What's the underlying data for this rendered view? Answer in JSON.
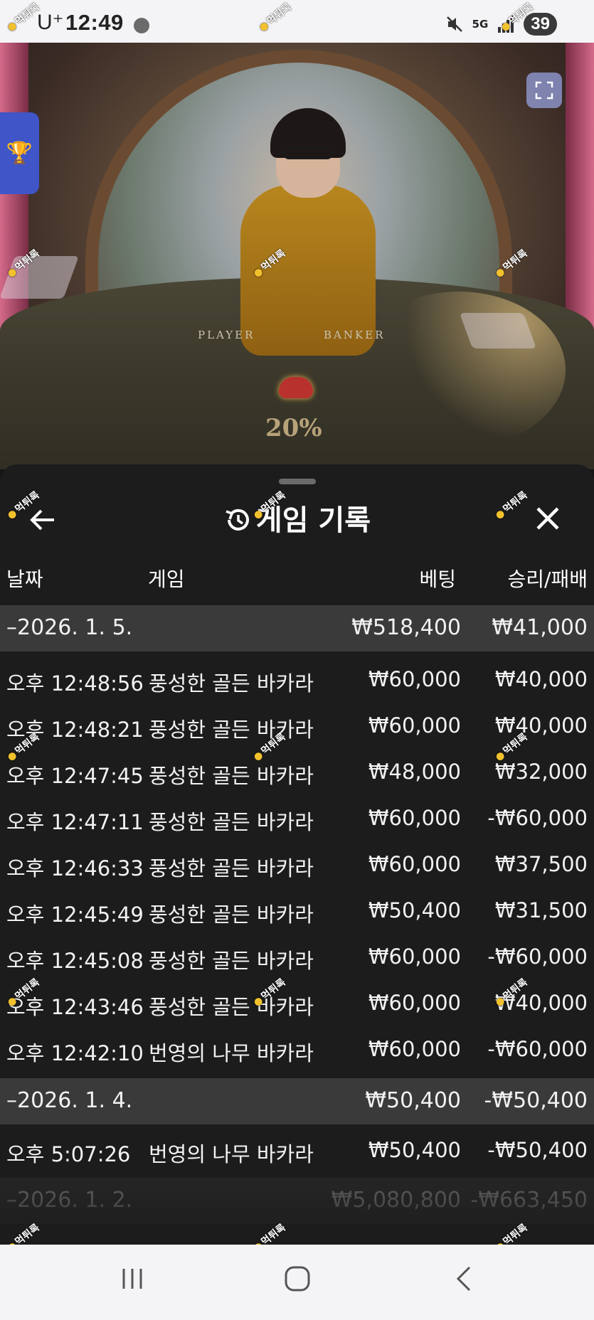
{
  "status_bar": {
    "carrier": "U⁺",
    "time": "12:49",
    "network": "5G",
    "battery": "39"
  },
  "video": {
    "table_left_label": "PLAYER",
    "table_right_label": "BANKER",
    "payout_percent": "20%"
  },
  "sheet": {
    "title": "게임 기록",
    "columns": {
      "date": "날짜",
      "game": "게임",
      "bet": "베팅",
      "result": "승리/패배"
    },
    "rows": [
      {
        "kind": "group",
        "date": "–2026. 1. 5.",
        "bet": "₩518,400",
        "result": "₩41,000"
      },
      {
        "kind": "item",
        "time": "오후 12:48:56",
        "game": "풍성한 골든 바카라",
        "bet": "₩60,000",
        "result": "₩40,000"
      },
      {
        "kind": "item",
        "time": "오후 12:48:21",
        "game": "풍성한 골든 바카라",
        "bet": "₩60,000",
        "result": "₩40,000"
      },
      {
        "kind": "item",
        "time": "오후 12:47:45",
        "game": "풍성한 골든 바카라",
        "bet": "₩48,000",
        "result": "₩32,000"
      },
      {
        "kind": "item",
        "time": "오후 12:47:11",
        "game": "풍성한 골든 바카라",
        "bet": "₩60,000",
        "result": "-₩60,000"
      },
      {
        "kind": "item",
        "time": "오후 12:46:33",
        "game": "풍성한 골든 바카라",
        "bet": "₩60,000",
        "result": "₩37,500"
      },
      {
        "kind": "item",
        "time": "오후 12:45:49",
        "game": "풍성한 골든 바카라",
        "bet": "₩50,400",
        "result": "₩31,500"
      },
      {
        "kind": "item",
        "time": "오후 12:45:08",
        "game": "풍성한 골든 바카라",
        "bet": "₩60,000",
        "result": "-₩60,000"
      },
      {
        "kind": "item",
        "time": "오후 12:43:46",
        "game": "풍성한 골든 바카라",
        "bet": "₩60,000",
        "result": "₩40,000"
      },
      {
        "kind": "item",
        "time": "오후 12:42:10",
        "game": "번영의 나무 바카라",
        "bet": "₩60,000",
        "result": "-₩60,000"
      },
      {
        "kind": "group",
        "date": "–2026. 1. 4.",
        "bet": "₩50,400",
        "result": "-₩50,400"
      },
      {
        "kind": "item",
        "time": "오후 5:07:26",
        "game": "번영의 나무 바카라",
        "bet": "₩50,400",
        "result": "-₩50,400"
      },
      {
        "kind": "group",
        "date": "–2026. 1. 2.",
        "bet": "₩5,080,800",
        "result": "-₩663,450"
      }
    ]
  },
  "watermark_text": "먹튀록",
  "colors": {
    "sheet_bg": "#1c1c1c",
    "group_row_bg": "#3a3a3a",
    "fullscreen_button": "#9aa2e0",
    "trophy_tab": "#3f55c8",
    "text": "#ffffff"
  },
  "icons": {
    "back": "arrow-left-icon",
    "close": "close-icon",
    "history": "history-icon",
    "fullscreen": "fullscreen-icon",
    "trophy": "trophy-icon",
    "nav_recents": "recents-icon",
    "nav_home": "home-icon",
    "nav_back": "back-icon"
  }
}
